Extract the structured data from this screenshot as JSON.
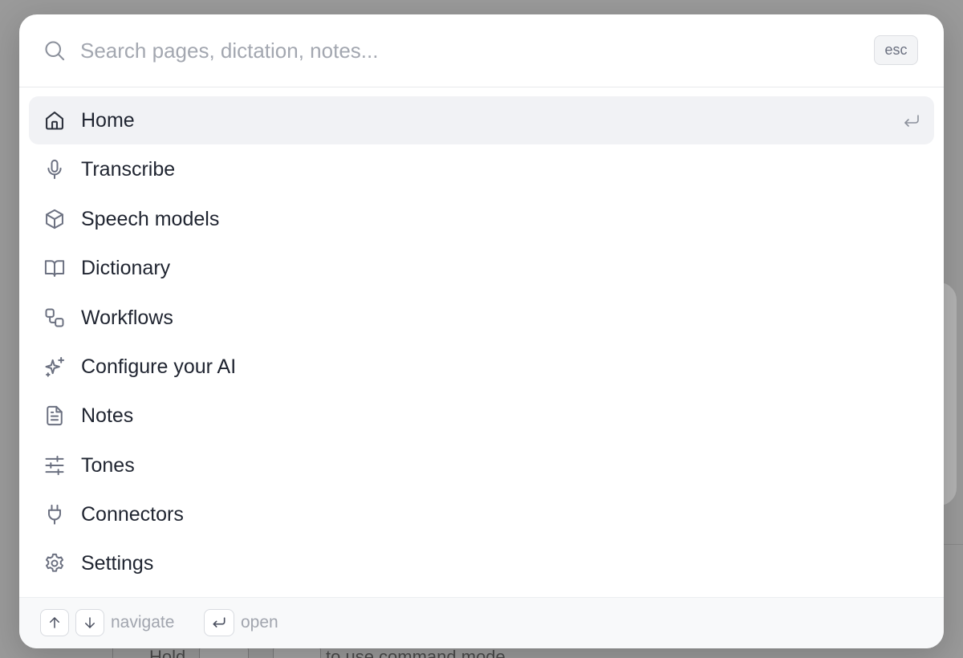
{
  "search": {
    "placeholder": "Search pages, dictation, notes...",
    "esc_label": "esc"
  },
  "items": [
    {
      "label": "Home",
      "icon": "home-icon",
      "active": true
    },
    {
      "label": "Transcribe",
      "icon": "microphone-icon"
    },
    {
      "label": "Speech models",
      "icon": "cube-icon"
    },
    {
      "label": "Dictionary",
      "icon": "book-open-icon"
    },
    {
      "label": "Workflows",
      "icon": "workflow-icon"
    },
    {
      "label": "Configure your AI",
      "icon": "sparkles-icon"
    },
    {
      "label": "Notes",
      "icon": "file-text-icon"
    },
    {
      "label": "Tones",
      "icon": "sliders-icon"
    },
    {
      "label": "Connectors",
      "icon": "plug-icon"
    },
    {
      "label": "Settings",
      "icon": "gear-icon"
    }
  ],
  "footer": {
    "navigate_label": "navigate",
    "open_label": "open"
  },
  "background": {
    "hint_prefix": "Hold",
    "hint_suffix": "to use command mode"
  },
  "colors": {
    "accent_text": "#1f2430",
    "muted_text": "#a1a5ae",
    "active_row": "#f1f2f5",
    "backdrop": "#9a9a9a"
  }
}
